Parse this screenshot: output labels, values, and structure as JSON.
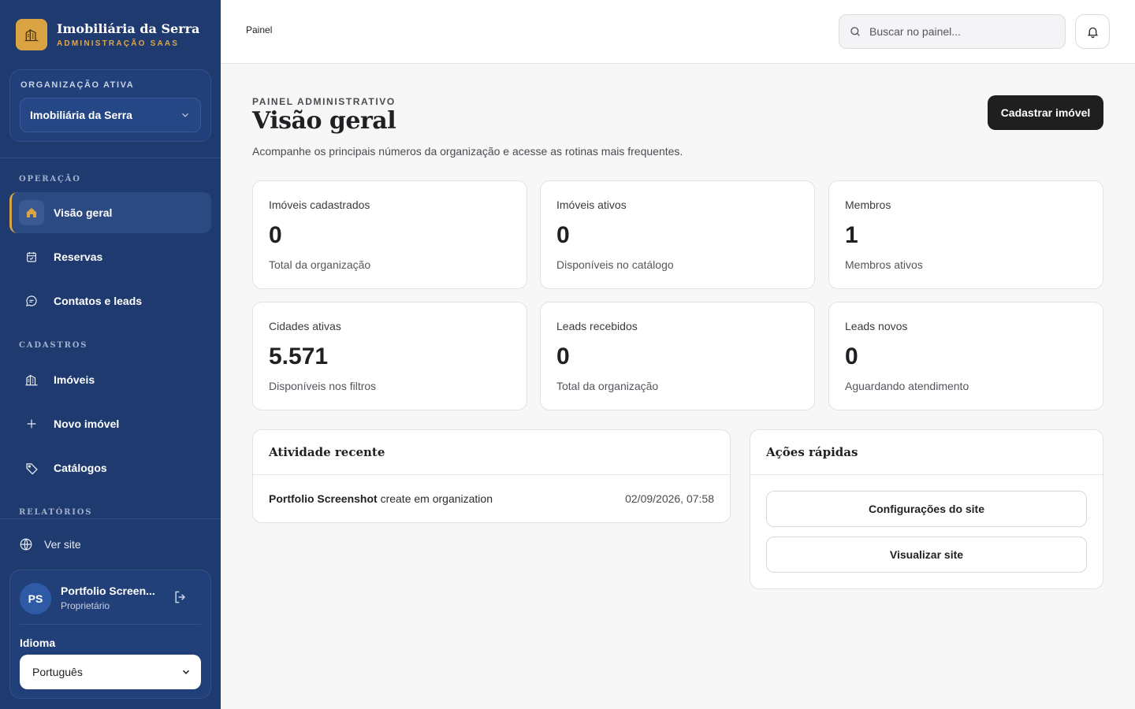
{
  "brand": {
    "name": "Imobiliária da Serra",
    "subtitle": "ADMINISTRAÇÃO SAAS",
    "logo_icon": "building-icon",
    "accent": "#d9a441"
  },
  "org": {
    "label": "ORGANIZAÇÃO ATIVA",
    "selected": "Imobiliária da Serra"
  },
  "sidebar": {
    "sections": {
      "operacao": "OPERAÇÃO",
      "cadastros": "CADASTROS",
      "relatorios": "RELATÓRIOS"
    },
    "items": [
      {
        "label": "Visão geral",
        "icon": "home-icon",
        "active": true
      },
      {
        "label": "Reservas",
        "icon": "calendar-icon"
      },
      {
        "label": "Contatos e leads",
        "icon": "chat-icon"
      },
      {
        "label": "Imóveis",
        "icon": "building-icon"
      },
      {
        "label": "Novo imóvel",
        "icon": "plus-icon"
      },
      {
        "label": "Catálogos",
        "icon": "tag-icon"
      }
    ],
    "ver_site": "Ver site",
    "background": "#1f3a6e"
  },
  "user": {
    "initials": "PS",
    "name": "Portfolio Screen...",
    "role": "Proprietário",
    "language_label": "Idioma",
    "language": "Português"
  },
  "topbar": {
    "breadcrumb": "Painel",
    "search_placeholder": "Buscar no painel..."
  },
  "main": {
    "eyebrow": "PAINEL ADMINISTRATIVO",
    "title": "Visão geral",
    "description": "Acompanhe os principais números da organização e acesse as rotinas mais frequentes.",
    "primary_button": "Cadastrar imóvel",
    "stats": [
      {
        "label": "Imóveis cadastrados",
        "value": "0",
        "sub": "Total da organização"
      },
      {
        "label": "Imóveis ativos",
        "value": "0",
        "sub": "Disponíveis no catálogo"
      },
      {
        "label": "Membros",
        "value": "1",
        "sub": "Membros ativos"
      },
      {
        "label": "Cidades ativas",
        "value": "5.571",
        "sub": "Disponíveis nos filtros"
      },
      {
        "label": "Leads recebidos",
        "value": "0",
        "sub": "Total da organização"
      },
      {
        "label": "Leads novos",
        "value": "0",
        "sub": "Aguardando atendimento"
      }
    ],
    "activity": {
      "title": "Atividade recente",
      "rows": [
        {
          "actor": "Portfolio Screenshot",
          "action": " create em organization",
          "time": "02/09/2026, 07:58"
        }
      ]
    },
    "quick_actions": {
      "title": "Ações rápidas",
      "buttons": [
        "Configurações do site",
        "Visualizar site"
      ]
    }
  }
}
